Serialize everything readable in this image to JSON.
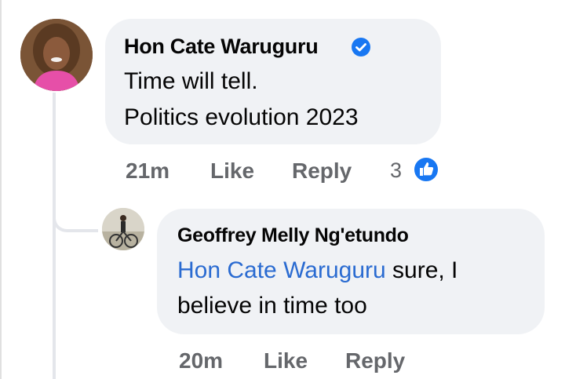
{
  "comment": {
    "author": "Hon Cate Waruguru",
    "verified_icon": "verified-badge-icon",
    "lines": [
      "Time will tell.",
      "Politics evolution 2023"
    ],
    "time": "21m",
    "like_label": "Like",
    "reply_label": "Reply",
    "reaction_count": "3",
    "reaction_icon": "like-reaction-icon"
  },
  "reply": {
    "author": "Geoffrey Melly Ng'etundo",
    "mention": "Hon Cate Waruguru",
    "line1_rest": " sure, I",
    "line2": "believe in time too",
    "time": "20m",
    "like_label": "Like",
    "reply_label": "Reply"
  },
  "colors": {
    "bubble": "#f0f2f5",
    "mention": "#2a6bd1",
    "meta": "#65676b",
    "like_blue": "#1877f2"
  }
}
